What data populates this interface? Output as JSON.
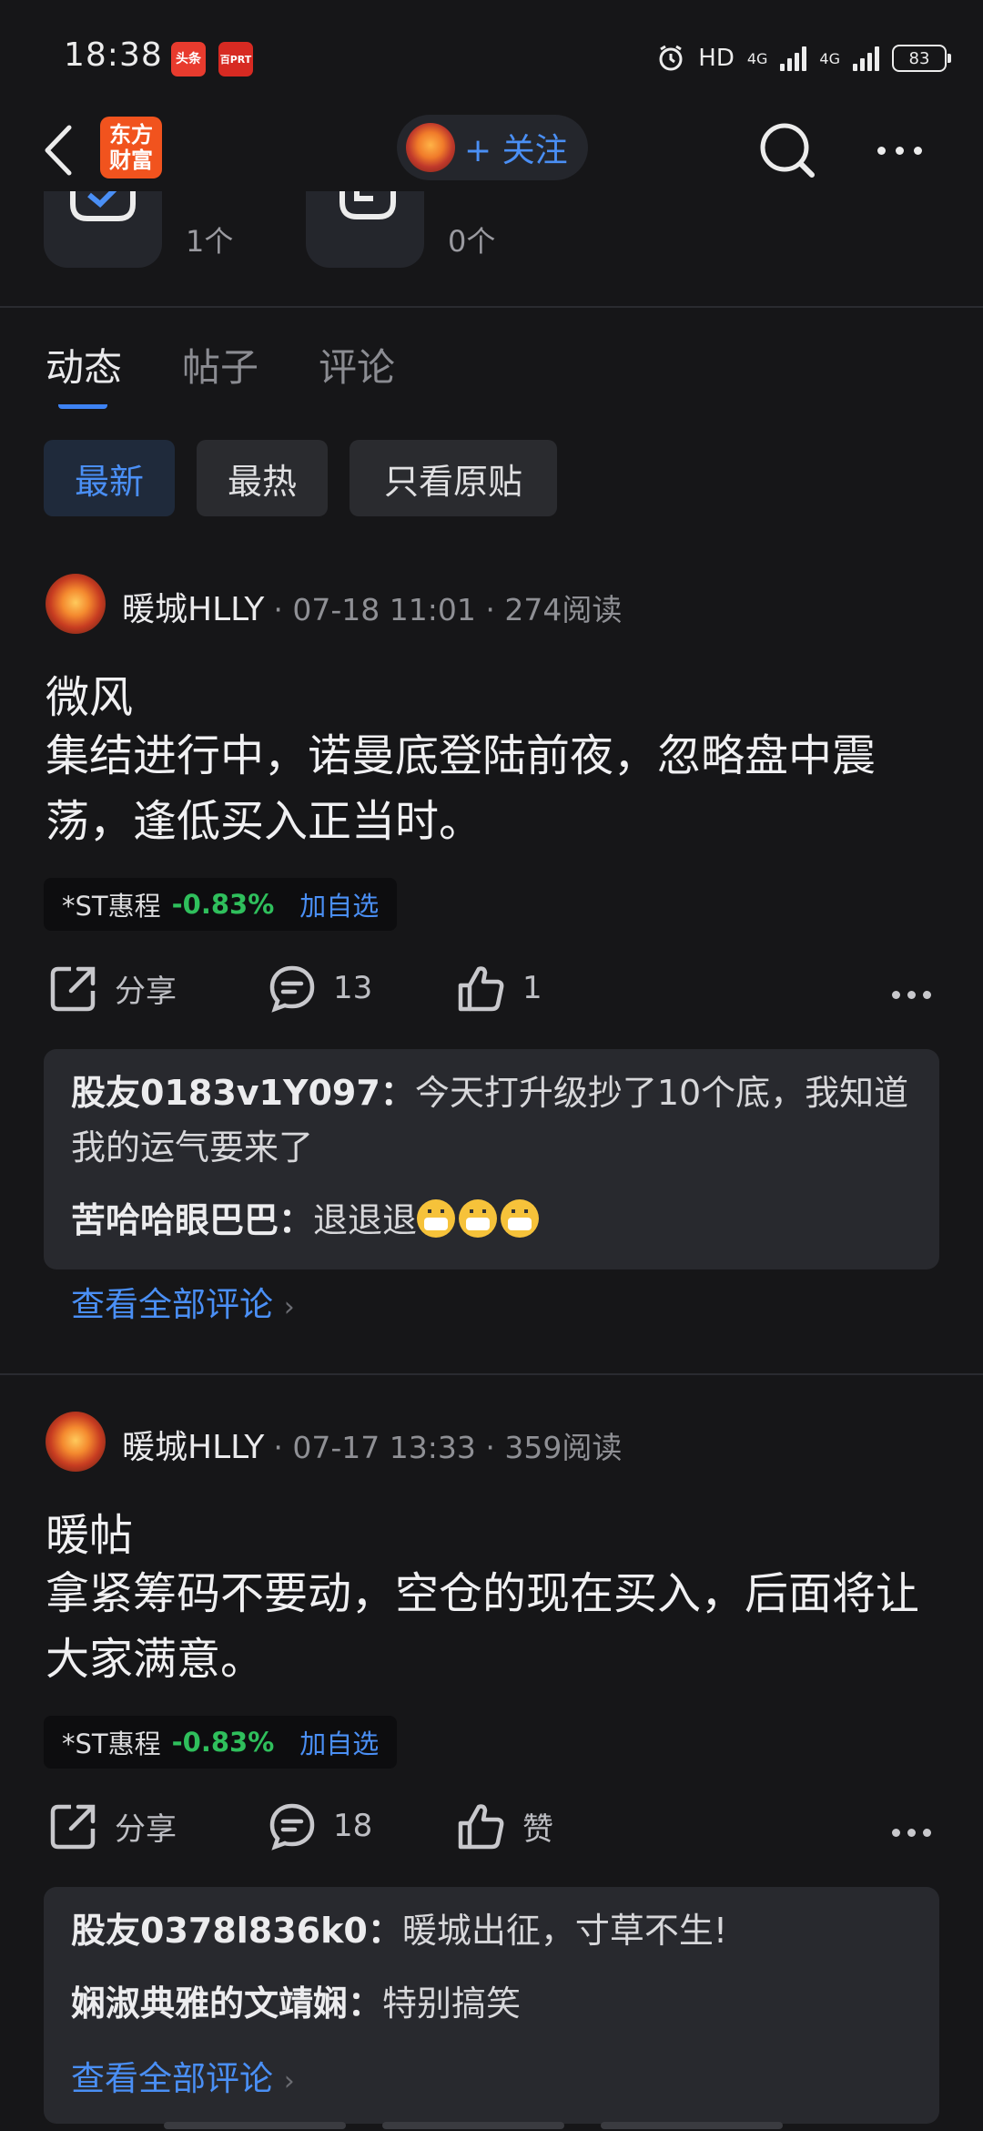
{
  "status_bar": {
    "time": "18:38",
    "apps": [
      {
        "label": "头条",
        "color": "#e83b2e"
      },
      {
        "label": "百PRT",
        "color": "#d72a22"
      }
    ],
    "network": "HD",
    "signal_1": "4G",
    "signal_2": "4G",
    "battery": "83"
  },
  "nav": {
    "logo_line1": "东方",
    "logo_line2": "财富",
    "follow_label": "+ 关注"
  },
  "stats": [
    {
      "count": "1个"
    },
    {
      "count": "0个"
    }
  ],
  "tabs": [
    {
      "label": "动态"
    },
    {
      "label": "帖子"
    },
    {
      "label": "评论"
    }
  ],
  "filters": [
    {
      "label": "最新"
    },
    {
      "label": "最热"
    },
    {
      "label": "只看原贴"
    }
  ],
  "posts": [
    {
      "author": "暖城HLLY",
      "meta": "· 07-18 11:01 · 274阅读",
      "title": "微风",
      "body": "集结进行中，诺曼底登陆前夜，忽略盘中震荡，逢低买入正当时。",
      "stock": {
        "name": "*ST惠程",
        "change": "-0.83%",
        "add": "加自选"
      },
      "share": "分享",
      "comments": "13",
      "likes": "1",
      "comment_list": [
        {
          "user": "股友0183v1Y097：",
          "text": "今天打升级抄了10个底，我知道我的运气要来了"
        },
        {
          "user": "苦哈哈眼巴巴：",
          "text": "退退退"
        }
      ],
      "view_all": "查看全部评论"
    },
    {
      "author": "暖城HLLY",
      "meta": "· 07-17 13:33 · 359阅读",
      "title": "暖帖",
      "body": "拿紧筹码不要动，空仓的现在买入，后面将让大家满意。",
      "stock": {
        "name": "*ST惠程",
        "change": "-0.83%",
        "add": "加自选"
      },
      "share": "分享",
      "comments": "18",
      "likes": "赞",
      "comment_list": [
        {
          "user": "股友0378l836k0：",
          "text": "暖城出征，寸草不生!"
        },
        {
          "user": "娴淑典雅的文靖娴：",
          "text": "特别搞笑"
        }
      ],
      "view_all": "查看全部评论"
    }
  ]
}
